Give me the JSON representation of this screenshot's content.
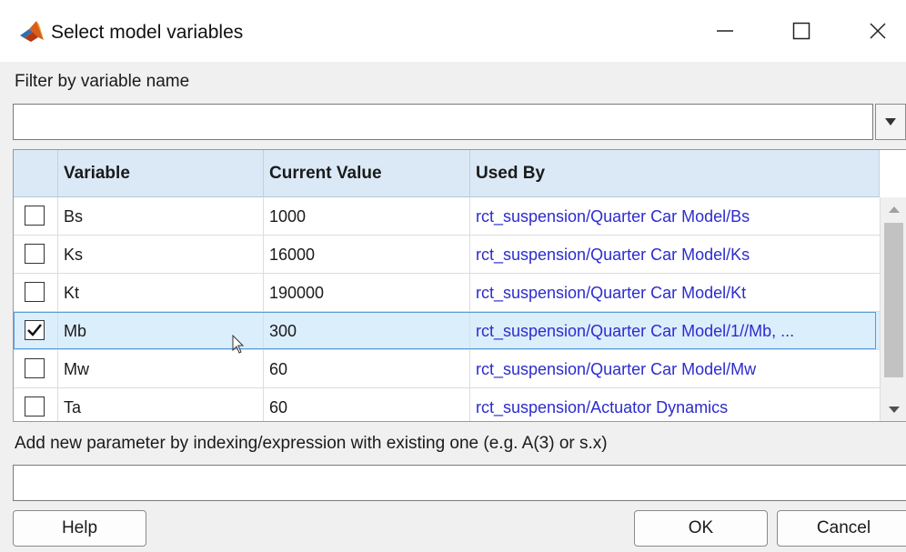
{
  "window": {
    "title": "Select model variables",
    "icon": "matlab-icon",
    "controls": [
      "minimize-icon",
      "maximize-icon",
      "close-icon"
    ]
  },
  "filter": {
    "label": "Filter by variable name",
    "value": "",
    "placeholder": ""
  },
  "table": {
    "columns": [
      "",
      "Variable",
      "Current Value",
      "Used By"
    ],
    "rows": [
      {
        "checked": false,
        "variable": "Bs",
        "value": "1000",
        "used_by": "rct_suspension/Quarter Car Model/Bs"
      },
      {
        "checked": false,
        "variable": "Ks",
        "value": "16000",
        "used_by": "rct_suspension/Quarter Car Model/Ks"
      },
      {
        "checked": false,
        "variable": "Kt",
        "value": "190000",
        "used_by": "rct_suspension/Quarter Car Model/Kt"
      },
      {
        "checked": true,
        "variable": "Mb",
        "value": "300",
        "used_by": "rct_suspension/Quarter Car Model/1//Mb, ...",
        "selected": true
      },
      {
        "checked": false,
        "variable": "Mw",
        "value": "60",
        "used_by": "rct_suspension/Quarter Car Model/Mw"
      },
      {
        "checked": false,
        "variable": "Ta",
        "value": "60",
        "used_by": "rct_suspension/Actuator Dynamics"
      }
    ]
  },
  "expression": {
    "label": "Add new parameter by indexing/expression with existing one (e.g. A(3) or s.x)",
    "value": "",
    "placeholder": ""
  },
  "buttons": {
    "help": "Help",
    "ok": "OK",
    "cancel": "Cancel"
  },
  "colors": {
    "header_bg": "#dbe9f7",
    "selected_row_bg": "#dbeefc",
    "link_text": "#2c2ccf",
    "accent": "#5b9bd5"
  }
}
